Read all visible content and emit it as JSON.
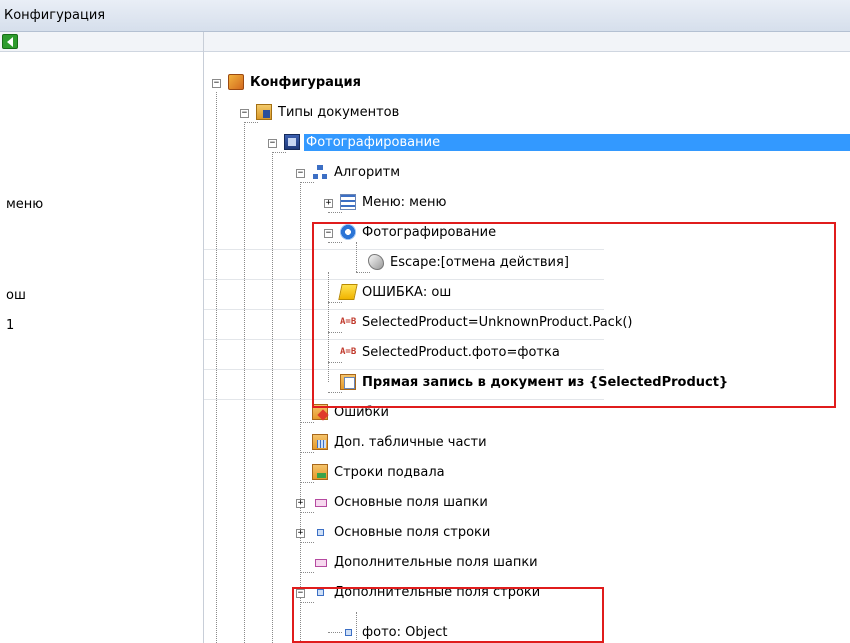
{
  "window": {
    "title": "Конфигурация"
  },
  "left_panel": {
    "labels": [
      {
        "text": "меню"
      },
      {
        "text": "ош"
      },
      {
        "text": "1"
      }
    ]
  },
  "tree": {
    "root": "Конфигурация",
    "doc_types": "Типы документов",
    "doc_photo": "Фотографирование",
    "algorithm": "Алгоритм",
    "menu_step": "Меню: меню",
    "photo_step": "Фотографирование",
    "escape_step": "Escape:[отмена действия]",
    "error_step": "ОШИБКА: ош",
    "assign_1": "SelectedProduct=UnknownProduct.Pack()",
    "assign_2": "SelectedProduct.фото=фотка",
    "direct_write": "Прямая запись в документ из {SelectedProduct}",
    "errors": "Ошибки",
    "extra_tables": "Доп. табличные части",
    "footer_rows": "Строки подвала",
    "header_fields": "Основные поля шапки",
    "row_fields": "Основные поля строки",
    "extra_header_fields": "Дополнительные поля шапки",
    "extra_row_fields": "Дополнительные поля строки",
    "photo_field": "фото: Object"
  }
}
